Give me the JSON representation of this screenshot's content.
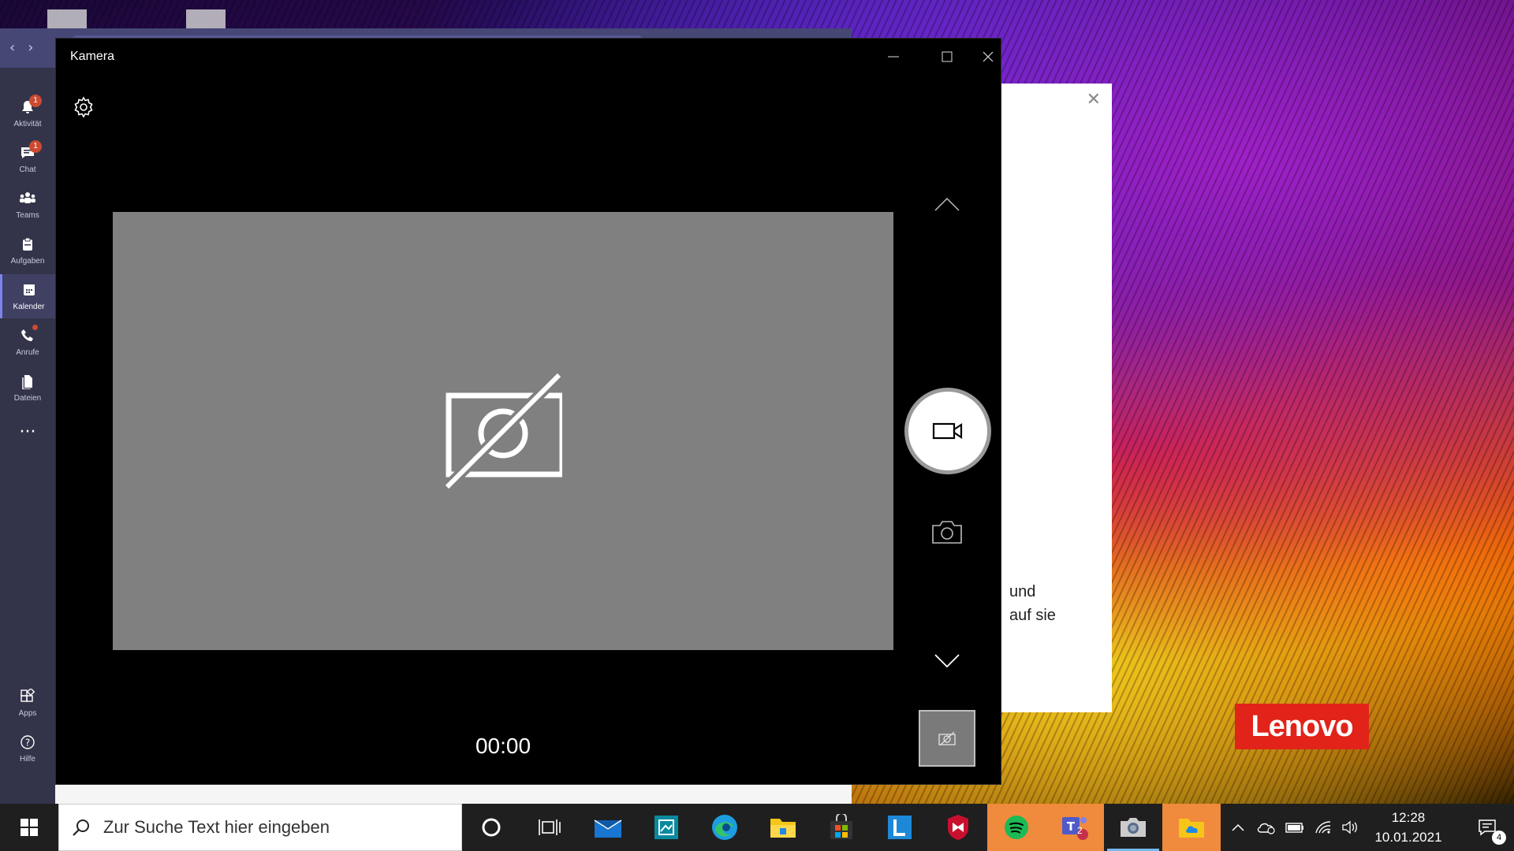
{
  "camera": {
    "title": "Kamera",
    "timer": "00:00"
  },
  "teams": {
    "rail": [
      {
        "label": "Aktivität",
        "icon": "bell-icon",
        "badge": "1"
      },
      {
        "label": "Chat",
        "icon": "chat-icon",
        "badge": "1"
      },
      {
        "label": "Teams",
        "icon": "teams-icon"
      },
      {
        "label": "Aufgaben",
        "icon": "tasks-icon"
      },
      {
        "label": "Kalender",
        "icon": "calendar-icon",
        "active": true
      },
      {
        "label": "Anrufe",
        "icon": "phone-icon",
        "dot": true
      },
      {
        "label": "Dateien",
        "icon": "files-icon"
      },
      {
        "label": "Apps",
        "icon": "apps-icon"
      },
      {
        "label": "Hilfe",
        "icon": "help-icon"
      }
    ]
  },
  "dialog": {
    "text_line1": "und",
    "text_line2": "auf sie"
  },
  "wallpaper": {
    "brand": "Lenovo"
  },
  "taskbar": {
    "search_placeholder": "Zur Suche Text hier eingeben",
    "teams_badge": "2",
    "time": "12:28",
    "date": "10.01.2021",
    "notification_count": "4"
  },
  "colors": {
    "teams_accent": "#464775",
    "teams_rail": "#33344a",
    "badge": "#cc4a31",
    "preview_gray": "#808080",
    "taskbar": "#1f1f1f",
    "lenovo_red": "#e2231a"
  }
}
